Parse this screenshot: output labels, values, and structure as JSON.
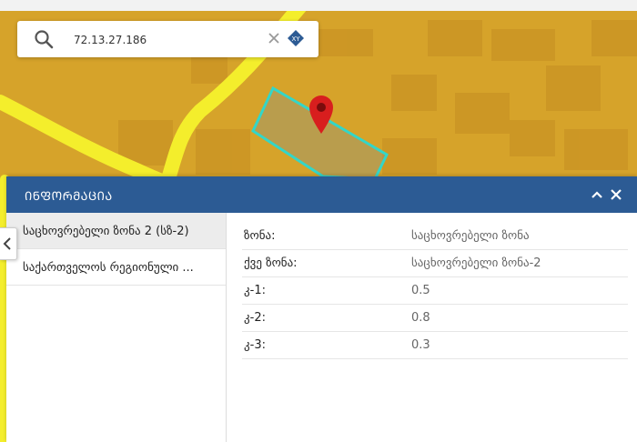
{
  "search": {
    "value": "72.13.27.186",
    "placeholder": ""
  },
  "panel": {
    "title": "ᲘᲜᲤᲝᲠᲛᲐᲪᲘᲐ",
    "side_items": [
      {
        "label": "საცხოვრებელი ზონა 2 (სზ-2)",
        "active": true
      },
      {
        "label": "საქართველოს რეგიონული ...",
        "active": false
      }
    ],
    "attributes": [
      {
        "key": "ზონა:",
        "value": "საცხოვრებელი ზონა"
      },
      {
        "key": "ქვე ზონა:",
        "value": "საცხოვრებელი ზონა-2"
      },
      {
        "key": "კ-1:",
        "value": "0.5"
      },
      {
        "key": "კ-2:",
        "value": "0.8"
      },
      {
        "key": "კ-3:",
        "value": "0.3"
      }
    ]
  },
  "map": {
    "xy_badge": "XY",
    "colors": {
      "zone_overlay": "#d9a62b",
      "road": "#f4ee2c",
      "parcel_outline": "#33d6c8",
      "marker": "#d81e1e",
      "panel_header": "#2c5b94"
    },
    "icons": [
      "search-icon",
      "clear-icon",
      "xy-icon",
      "map-marker-icon",
      "collapse-icon",
      "close-icon",
      "chevron-left-icon"
    ]
  }
}
